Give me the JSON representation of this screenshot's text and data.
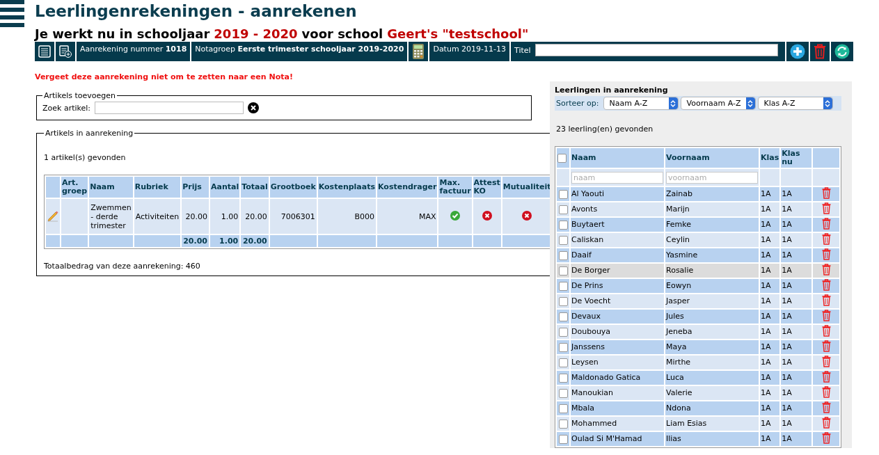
{
  "page_title": "Leerlingenrekeningen - aanrekenen",
  "context": {
    "prefix": "Je werkt nu in schooljaar",
    "year": "2019 - 2020",
    "middle": "voor school",
    "school": "Geert's \"testschool\""
  },
  "toolbar": {
    "number_label": "Aanrekening nummer",
    "number": "1018",
    "group_label": "Notagroep",
    "group": "Eerste trimester schooljaar 2019-2020",
    "date_label": "Datum",
    "date": "2019-11-13",
    "title_label": "Titel"
  },
  "warning": "Vergeet deze aanrekening niet om te zetten naar een Nota!",
  "add_articles": {
    "legend": "Artikels toevoegen",
    "search_label": "Zoek artikel:"
  },
  "articles": {
    "legend": "Artikels in aanrekening",
    "count": "1 artikel(s) gevonden",
    "columns": [
      "Art. groep",
      "Naam",
      "Rubriek",
      "Prijs",
      "Aantal",
      "Totaal",
      "Grootboek",
      "Kostenplaats",
      "Kostendrager",
      "Max. factuur",
      "Attest KO",
      "Mutualiteit"
    ],
    "rows": [
      {
        "art_groep": "",
        "naam": "Zwemmen - derde trimester",
        "rubriek": "Activiteiten",
        "prijs": "20.00",
        "aantal": "1.00",
        "totaal": "20.00",
        "grootboek": "7006301",
        "kostenplaats": "B000",
        "kostendrager": "MAX",
        "max_factuur": true,
        "attest_ko": false,
        "mutualiteit": false
      }
    ],
    "totals": {
      "prijs": "20.00",
      "aantal": "1.00",
      "totaal": "20.00"
    },
    "total_text": "Totaalbedrag van deze aanrekening: 460"
  },
  "students": {
    "title": "Leerlingen in aanrekening",
    "sort_label": "Sorteer op:",
    "sorts": [
      "Naam A-Z",
      "Voornaam A-Z",
      "Klas A-Z"
    ],
    "count": "23 leerling(en) gevonden",
    "columns": [
      "Naam",
      "Voornaam",
      "Klas",
      "Klas nu"
    ],
    "select_all_checked": false,
    "filters": [
      {
        "placeholder": "naam"
      },
      {
        "placeholder": "voornaam"
      }
    ],
    "rows": [
      {
        "naam": "Al Yaouti",
        "voornaam": "Zainab",
        "klas": "1A",
        "klas_nu": "1A",
        "checked": false,
        "highlighted": false
      },
      {
        "naam": "Avonts",
        "voornaam": "Marijn",
        "klas": "1A",
        "klas_nu": "1A",
        "checked": false,
        "highlighted": false
      },
      {
        "naam": "Buytaert",
        "voornaam": "Femke",
        "klas": "1A",
        "klas_nu": "1A",
        "checked": false,
        "highlighted": false
      },
      {
        "naam": "Caliskan",
        "voornaam": "Ceylin",
        "klas": "1A",
        "klas_nu": "1A",
        "checked": false,
        "highlighted": false
      },
      {
        "naam": "Daaif",
        "voornaam": "Yasmine",
        "klas": "1A",
        "klas_nu": "1A",
        "checked": false,
        "highlighted": false
      },
      {
        "naam": "De Borger",
        "voornaam": "Rosalie",
        "klas": "1A",
        "klas_nu": "1A",
        "checked": false,
        "highlighted": true
      },
      {
        "naam": "De Prins",
        "voornaam": "Eowyn",
        "klas": "1A",
        "klas_nu": "1A",
        "checked": false,
        "highlighted": false
      },
      {
        "naam": "De Voecht",
        "voornaam": "Jasper",
        "klas": "1A",
        "klas_nu": "1A",
        "checked": false,
        "highlighted": false
      },
      {
        "naam": "Devaux",
        "voornaam": "Jules",
        "klas": "1A",
        "klas_nu": "1A",
        "checked": false,
        "highlighted": false
      },
      {
        "naam": "Doubouya",
        "voornaam": "Jeneba",
        "klas": "1A",
        "klas_nu": "1A",
        "checked": false,
        "highlighted": false
      },
      {
        "naam": "Janssens",
        "voornaam": "Maya",
        "klas": "1A",
        "klas_nu": "1A",
        "checked": false,
        "highlighted": false
      },
      {
        "naam": "Leysen",
        "voornaam": "Mirthe",
        "klas": "1A",
        "klas_nu": "1A",
        "checked": false,
        "highlighted": false
      },
      {
        "naam": "Maldonado Gatica",
        "voornaam": "Luca",
        "klas": "1A",
        "klas_nu": "1A",
        "checked": false,
        "highlighted": false
      },
      {
        "naam": "Manoukian",
        "voornaam": "Valerie",
        "klas": "1A",
        "klas_nu": "1A",
        "checked": false,
        "highlighted": false
      },
      {
        "naam": "Mbala",
        "voornaam": "Ndona",
        "klas": "1A",
        "klas_nu": "1A",
        "checked": false,
        "highlighted": false
      },
      {
        "naam": "Mohammed",
        "voornaam": "Liam Esias",
        "klas": "1A",
        "klas_nu": "1A",
        "checked": false,
        "highlighted": false
      },
      {
        "naam": "Oulad Si M'Hamad",
        "voornaam": "Ilias",
        "klas": "1A",
        "klas_nu": "1A",
        "checked": false,
        "highlighted": false
      }
    ]
  }
}
